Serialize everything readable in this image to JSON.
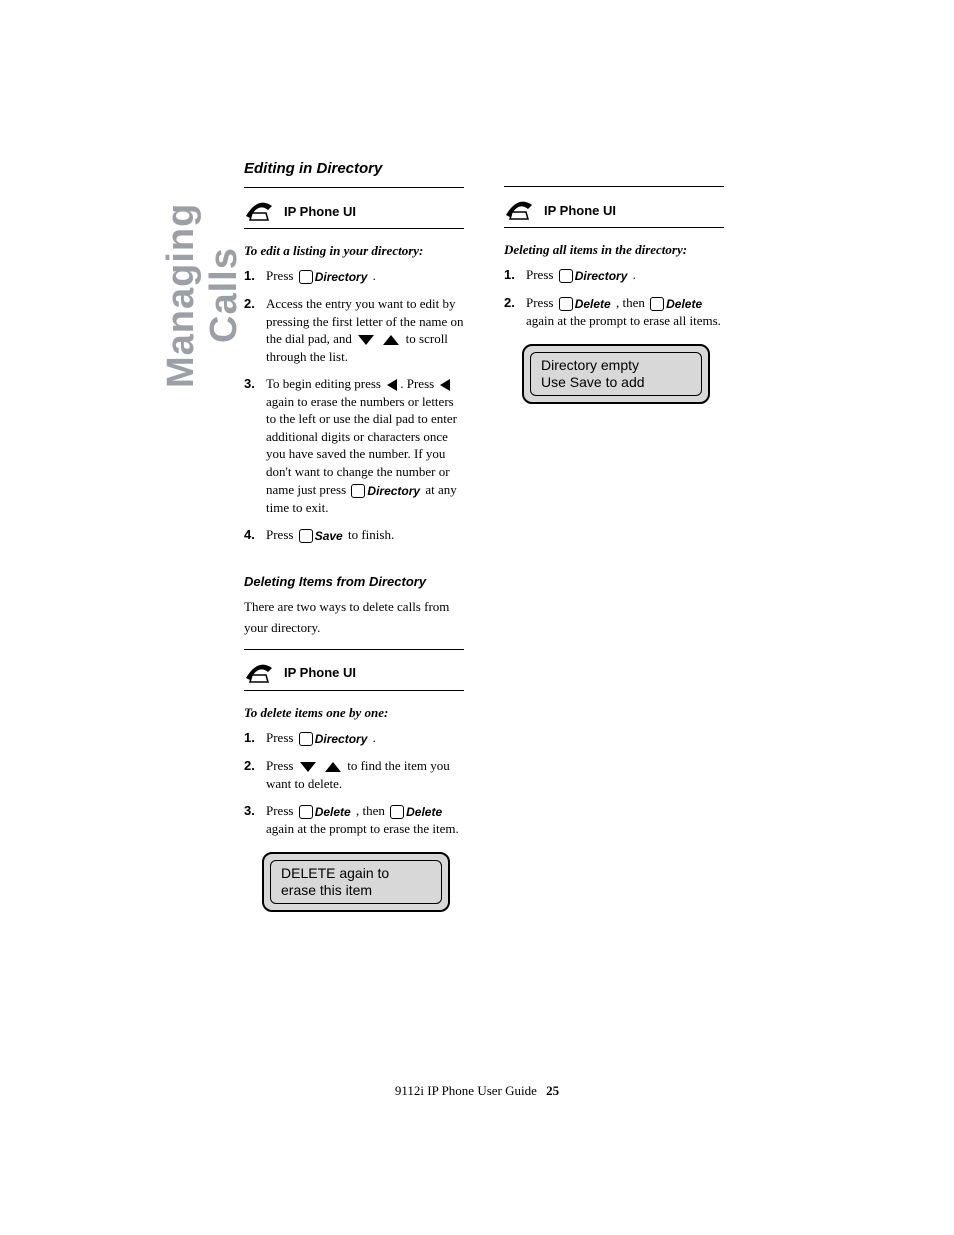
{
  "side_tab": "Managing Calls",
  "phone_ui_label": "IP Phone UI",
  "keys": {
    "directory": "Directory",
    "save": "Save",
    "delete": "Delete"
  },
  "left": {
    "section1_title": "Editing in Directory",
    "proc1_title": "To edit a listing in your directory:",
    "steps1": {
      "s1_a": "Press",
      "s1_b": ".",
      "s2_a": "Access the entry you want to edit by pressing the first letter of the name on the dial pad, and",
      "s2_b": "to scroll through the list.",
      "s3_a": "To begin editing press",
      "s3_b": ". Press",
      "s3_c": "again to erase the numbers or letters to the left or use the dial pad to enter additional digits or characters once you have saved the number.  If you don't want to change the number or name just press",
      "s3_d": "at any time to exit.",
      "s4_a": "Press",
      "s4_b": "to finish."
    },
    "section2_title": "Deleting Items from Directory",
    "section2_body": "There are two ways to delete calls from your directory.",
    "proc2_title": "To delete items one by one:",
    "steps2": {
      "s1_a": "Press",
      "s1_b": ".",
      "s2_a": "Press",
      "s2_b": "to find the item you want to delete.",
      "s3_a": "Press",
      "s3_b": ", then",
      "s3_c": "again at the prompt to erase the item."
    },
    "lcd": {
      "line1": "DELETE again to",
      "line2": "erase this item"
    }
  },
  "right": {
    "proc_title": "Deleting all items in the directory:",
    "steps": {
      "s1_a": "Press",
      "s1_b": ".",
      "s2_a": "Press",
      "s2_b": ", then",
      "s2_c": "again at the prompt to erase all items."
    },
    "lcd": {
      "line1": "Directory empty",
      "line2": "Use Save to add"
    }
  },
  "footer": {
    "text": "9112i IP Phone User Guide",
    "page": "25"
  }
}
